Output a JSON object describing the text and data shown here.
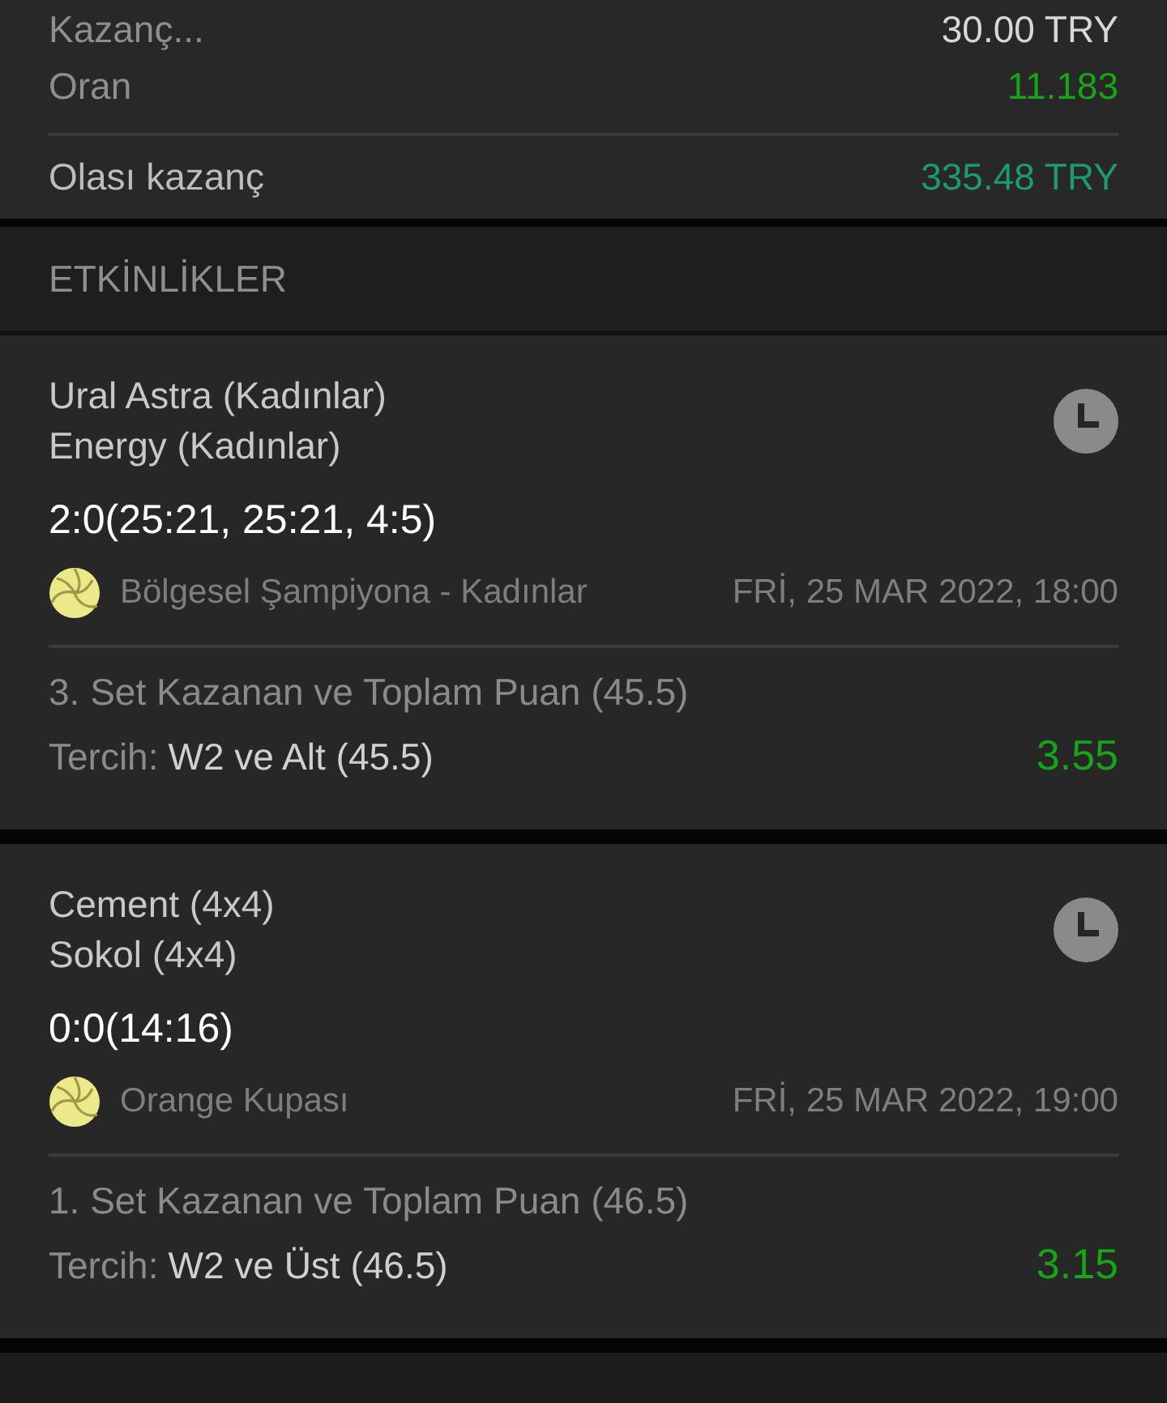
{
  "summary": [
    {
      "label": "Kazanç...",
      "value": "30.00 TRY",
      "kind": "stake"
    },
    {
      "label": "Oran",
      "value": "11.183",
      "kind": "odds"
    },
    {
      "label": "Olası kazanç",
      "value": "335.48 TRY",
      "kind": "payout"
    }
  ],
  "section_title": "ETKİNLİKLER",
  "events": [
    {
      "home": "Ural Astra (Kadınlar)",
      "away": "Energy (Kadınlar)",
      "score": "2:0(25:21, 25:21, 4:5)",
      "league": "Bölgesel Şampiyona - Kadınlar",
      "date": "FRİ, 25 MAR 2022, 18:00",
      "market": "3. Set Kazanan ve Toplam Puan (45.5)",
      "choice_label": "Tercih:",
      "choice": "W2 ve Alt (45.5)",
      "odds": "3.55"
    },
    {
      "home": "Cement (4x4)",
      "away": "Sokol (4x4)",
      "score": "0:0(14:16)",
      "league": "Orange Kupası",
      "date": "FRİ, 25 MAR 2022, 19:00",
      "market": "1. Set Kazanan ve Toplam Puan (46.5)",
      "choice_label": "Tercih:",
      "choice": "W2 ve Üst (46.5)",
      "odds": "3.15"
    }
  ]
}
